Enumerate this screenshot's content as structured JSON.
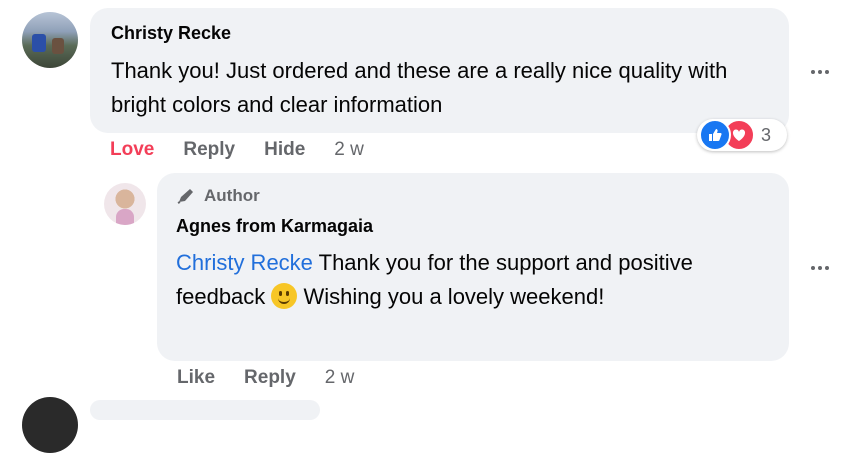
{
  "comment": {
    "author_name": "Christy Recke",
    "text": "Thank you! Just ordered and these are a really nice quality with bright colors and clear information",
    "actions": {
      "love": "Love",
      "reply": "Reply",
      "hide": "Hide",
      "time": "2 w"
    },
    "reactions": {
      "icons": [
        "like-icon",
        "love-icon"
      ],
      "count": "3"
    },
    "more_icon": "more-options-icon"
  },
  "reply": {
    "badge_label": "Author",
    "author_name": "Agnes from Karmagaia",
    "mention": "Christy Recke",
    "text_before_emoji": " Thank you for the support and positive feedback ",
    "emoji": "slightly-smiling-face",
    "text_after_emoji": " Wishing you a lovely weekend!",
    "actions": {
      "like": "Like",
      "reply": "Reply",
      "time": "2 w"
    },
    "more_icon": "more-options-icon"
  },
  "colors": {
    "bubble": "#f0f2f5",
    "mention": "#216fdb",
    "love": "#f33e58",
    "like": "#1877f2",
    "muted": "#65676b"
  }
}
